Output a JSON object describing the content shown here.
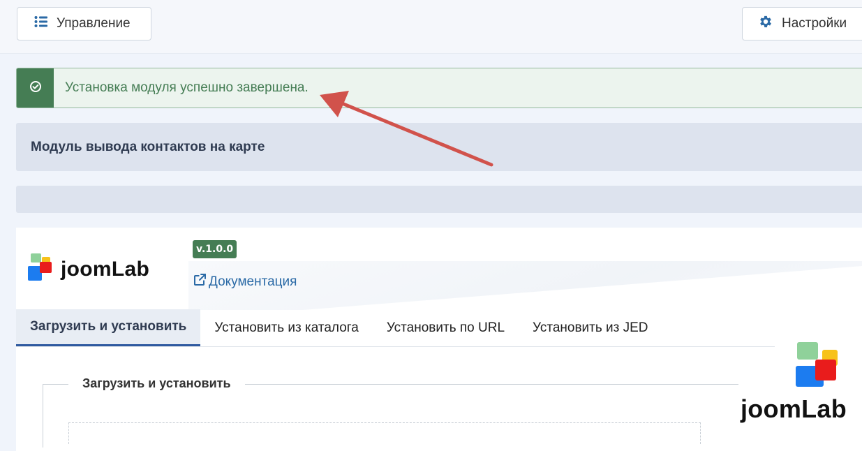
{
  "toolbar": {
    "manage_label": "Управление",
    "settings_label": "Настройки"
  },
  "alert": {
    "message": "Установка модуля успешно завершена."
  },
  "module": {
    "title": "Модуль вывода контактов на карте"
  },
  "brand": {
    "name": "joomLab",
    "version": "v.1.0.0",
    "docs_label": "Документация"
  },
  "tabs": [
    {
      "label": "Загрузить и установить",
      "active": true
    },
    {
      "label": "Установить из каталога",
      "active": false
    },
    {
      "label": "Установить по URL",
      "active": false
    },
    {
      "label": "Установить из JED",
      "active": false
    }
  ],
  "upload_section": {
    "legend": "Загрузить и установить"
  },
  "watermark": {
    "name": "joomLab"
  },
  "colors": {
    "success": "#457d54",
    "annotation_arrow": "#d1524b",
    "logo_green": "#8fd19a",
    "logo_yellow": "#f7c21b",
    "logo_red": "#e91c1c",
    "logo_blue": "#1c7cf0"
  }
}
